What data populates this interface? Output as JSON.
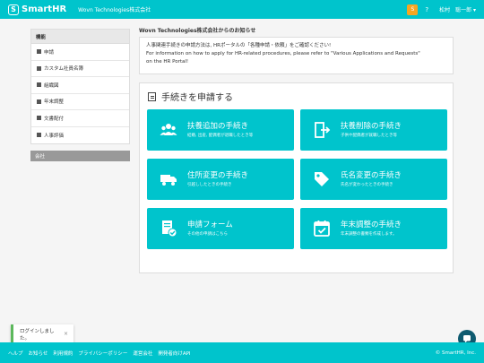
{
  "header": {
    "logo_mark": "S",
    "logo_text": "SmartHR",
    "company_name": "Wovn Technologies株式会社",
    "avatar_letter": "S",
    "help": "?",
    "user_last": "松村",
    "user_first": "聡一郎 ▾"
  },
  "sidebar": {
    "heading": "機能",
    "items": [
      {
        "label": "申請"
      },
      {
        "label": "カスタム社員名簿"
      },
      {
        "label": "組織図"
      },
      {
        "label": "年末調整"
      },
      {
        "label": "文書配付"
      },
      {
        "label": "人事評価"
      }
    ],
    "company_label": "会社"
  },
  "notice": {
    "title": "Wovn Technologies株式会社からのお知らせ",
    "line1": "人事関連手続きの申請方法は, HRポータルの「各種申請・依頼」をご確認ください!",
    "line2": "For information on how to apply for HR-related procedures, please refer to \"Various Applications and Requests\"",
    "line3": "on the HR Portal!"
  },
  "apply": {
    "title": "手続きを申請する",
    "tiles": [
      {
        "title": "扶養追加の手続き",
        "desc": "結婚, 出産, 配偶者が退職したとき等",
        "icon": "people-icon"
      },
      {
        "title": "扶養削除の手続き",
        "desc": "子供や配偶者が就職したとき等",
        "icon": "exit-door-icon"
      },
      {
        "title": "住所変更の手続き",
        "desc": "引越ししたときの手続き",
        "icon": "truck-icon"
      },
      {
        "title": "氏名変更の手続き",
        "desc": "氏名が変わったときの手続き",
        "icon": "tag-icon"
      },
      {
        "title": "申請フォーム",
        "desc": "その他の申請はこちら",
        "icon": "form-check-icon"
      },
      {
        "title": "年末調整の手続き",
        "desc": "年末調整の書類を作成します。",
        "icon": "calendar-check-icon"
      }
    ]
  },
  "toast": {
    "message": "ログインしました。",
    "close": "×"
  },
  "footer": {
    "links": [
      "ヘルプ",
      "お知らせ",
      "利用規約",
      "プライバシーポリシー",
      "運営会社",
      "開発者向けAPI"
    ],
    "copyright": "© SmartHR, Inc."
  },
  "colors": {
    "brand": "#00c4cc",
    "chat": "#0e5a6f",
    "toast_accent": "#5cb85c",
    "avatar": "#f5a623"
  }
}
